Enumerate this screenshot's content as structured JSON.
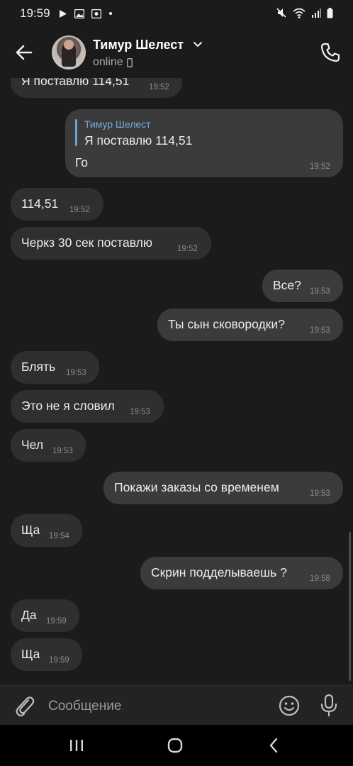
{
  "status_bar": {
    "time": "19:59"
  },
  "header": {
    "contact_name": "Тимур Шелест",
    "contact_status": "online"
  },
  "messages": [
    {
      "dir": "in",
      "text": "Я поставлю 114,51",
      "time": "19:52"
    },
    {
      "dir": "out",
      "reply_author": "Тимур Шелест",
      "reply_text": "Я поставлю 114,51",
      "text": "Го",
      "time": "19:52"
    },
    {
      "dir": "in",
      "text": "114,51",
      "time": "19:52"
    },
    {
      "dir": "in",
      "text": "Черкз 30 сек поставлю",
      "time": "19:52"
    },
    {
      "dir": "out",
      "text": "Все?",
      "time": "19:53"
    },
    {
      "dir": "out",
      "text": "Ты сын сковородки?",
      "time": "19:53"
    },
    {
      "dir": "in",
      "text": "Блять",
      "time": "19:53"
    },
    {
      "dir": "in",
      "text": "Это не я словил",
      "time": "19:53"
    },
    {
      "dir": "in",
      "text": "Чел",
      "time": "19:53"
    },
    {
      "dir": "out",
      "text": "Покажи заказы со временем",
      "time": "19:53"
    },
    {
      "dir": "in",
      "text": "Ща",
      "time": "19:54"
    },
    {
      "dir": "out",
      "text": "Скрин подделываешь ?",
      "time": "19:58"
    },
    {
      "dir": "in",
      "text": "Да",
      "time": "19:59"
    },
    {
      "dir": "in",
      "text": "Ща",
      "time": "19:59"
    }
  ],
  "composer": {
    "placeholder": "Сообщение"
  },
  "icons": {
    "back": "arrow-left-icon",
    "call": "phone-icon",
    "attach": "paperclip-icon",
    "emoji": "smiley-icon",
    "mic": "microphone-icon"
  },
  "colors": {
    "background": "#1b1b1b",
    "bubble_in": "#2f2f2f",
    "bubble_out": "#3b3b3b",
    "reply_accent": "#7aa7dd"
  }
}
